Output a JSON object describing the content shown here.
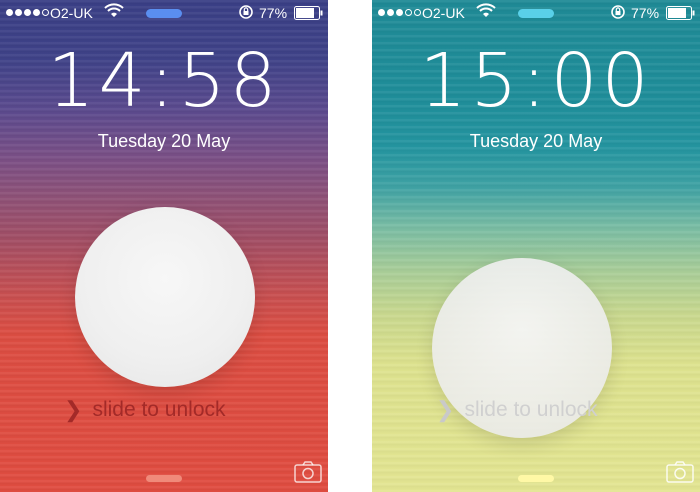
{
  "screens": [
    {
      "id": "left",
      "status": {
        "carrier": "O2-UK",
        "battery": "77%",
        "signal_bars": 4,
        "signal_total": 5,
        "pill_color": "#5a8ef0"
      },
      "time": "14:58",
      "date": "Tuesday 20 May",
      "slide_text": "slide to unlock",
      "home_bar_color": "#f08a7a"
    },
    {
      "id": "right",
      "status": {
        "carrier": "O2-UK",
        "battery": "77%",
        "signal_bars": 3,
        "signal_total": 5,
        "pill_color": "#59d0e8"
      },
      "time": "15:00",
      "date": "Tuesday 20 May",
      "slide_text": "slide to unlock",
      "home_bar_color": "#fff8a6"
    }
  ],
  "icons": [
    "wifi-icon",
    "rotation-lock-icon",
    "battery-icon",
    "chevron-right-icon",
    "camera-icon"
  ]
}
